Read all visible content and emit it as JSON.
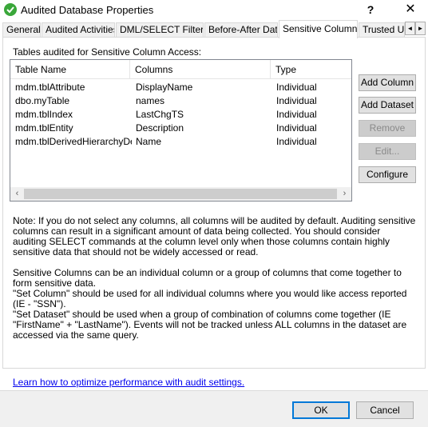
{
  "window": {
    "title": "Audited Database Properties",
    "help_glyph": "?",
    "close_glyph": "✕"
  },
  "tabs": [
    {
      "label": "General"
    },
    {
      "label": "Audited Activities"
    },
    {
      "label": "DML/SELECT Filters"
    },
    {
      "label": "Before-After Data"
    },
    {
      "label": "Sensitive Columns",
      "active": true
    },
    {
      "label": "Trusted Us"
    }
  ],
  "tab_scroll": {
    "left": "◄",
    "right": "►"
  },
  "section_label": "Tables audited for Sensitive Column Access:",
  "table": {
    "columns": [
      "Table Name",
      "Columns",
      "Type"
    ],
    "rows": [
      [
        "mdm.tblAttribute",
        "DisplayName",
        "Individual"
      ],
      [
        "dbo.myTable",
        "names",
        "Individual"
      ],
      [
        "mdm.tblIndex",
        "LastChgTS",
        "Individual"
      ],
      [
        "mdm.tblEntity",
        "Description",
        "Individual"
      ],
      [
        "mdm.tblDerivedHierarchyDe...",
        "Name",
        "Individual"
      ]
    ],
    "scroll_left": "‹",
    "scroll_right": "›"
  },
  "buttons": {
    "add_column": "Add Column",
    "add_dataset": "Add Dataset",
    "remove": "Remove",
    "edit": "Edit...",
    "configure": "Configure"
  },
  "notes": {
    "note1": "Note: If you do not select any columns, all columns will be audited by default. Auditing sensitive columns can result in a significant amount of data being collected.  You should consider auditing SELECT commands at the column level only when those columns contain highly sensitive data that should not be widely accessed or read.",
    "note2a": "Sensitive Columns can be an individual column or a group of columns that come together to form sensitive data.",
    "note2b": "\"Set Column\" should be used for all individual columns where you would like access reported (IE - \"SSN\").",
    "note3": "\"Set Dataset\" should be used when a group of combination of columns come together (IE \"FirstName\" + \"LastName\"). Events will not be tracked unless ALL columns in the dataset are accessed via the same query."
  },
  "footer": {
    "link": "Learn how to optimize performance with audit settings.",
    "ok": "OK",
    "cancel": "Cancel"
  },
  "colors": {
    "accent": "#0078d7",
    "link": "#0000ee",
    "app_icon": "#3aa73a"
  }
}
